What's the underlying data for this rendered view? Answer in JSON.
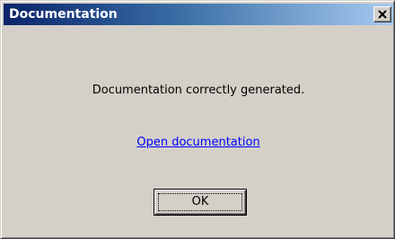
{
  "window": {
    "title": "Documentation",
    "close_icon": "close-icon"
  },
  "dialog": {
    "message": "Documentation correctly generated.",
    "link_label": "Open documentation",
    "ok_label": "OK"
  },
  "colors": {
    "titlebar_start": "#0a246a",
    "titlebar_end": "#a6caf0",
    "face": "#d4d0c8",
    "link": "#0000ff"
  }
}
